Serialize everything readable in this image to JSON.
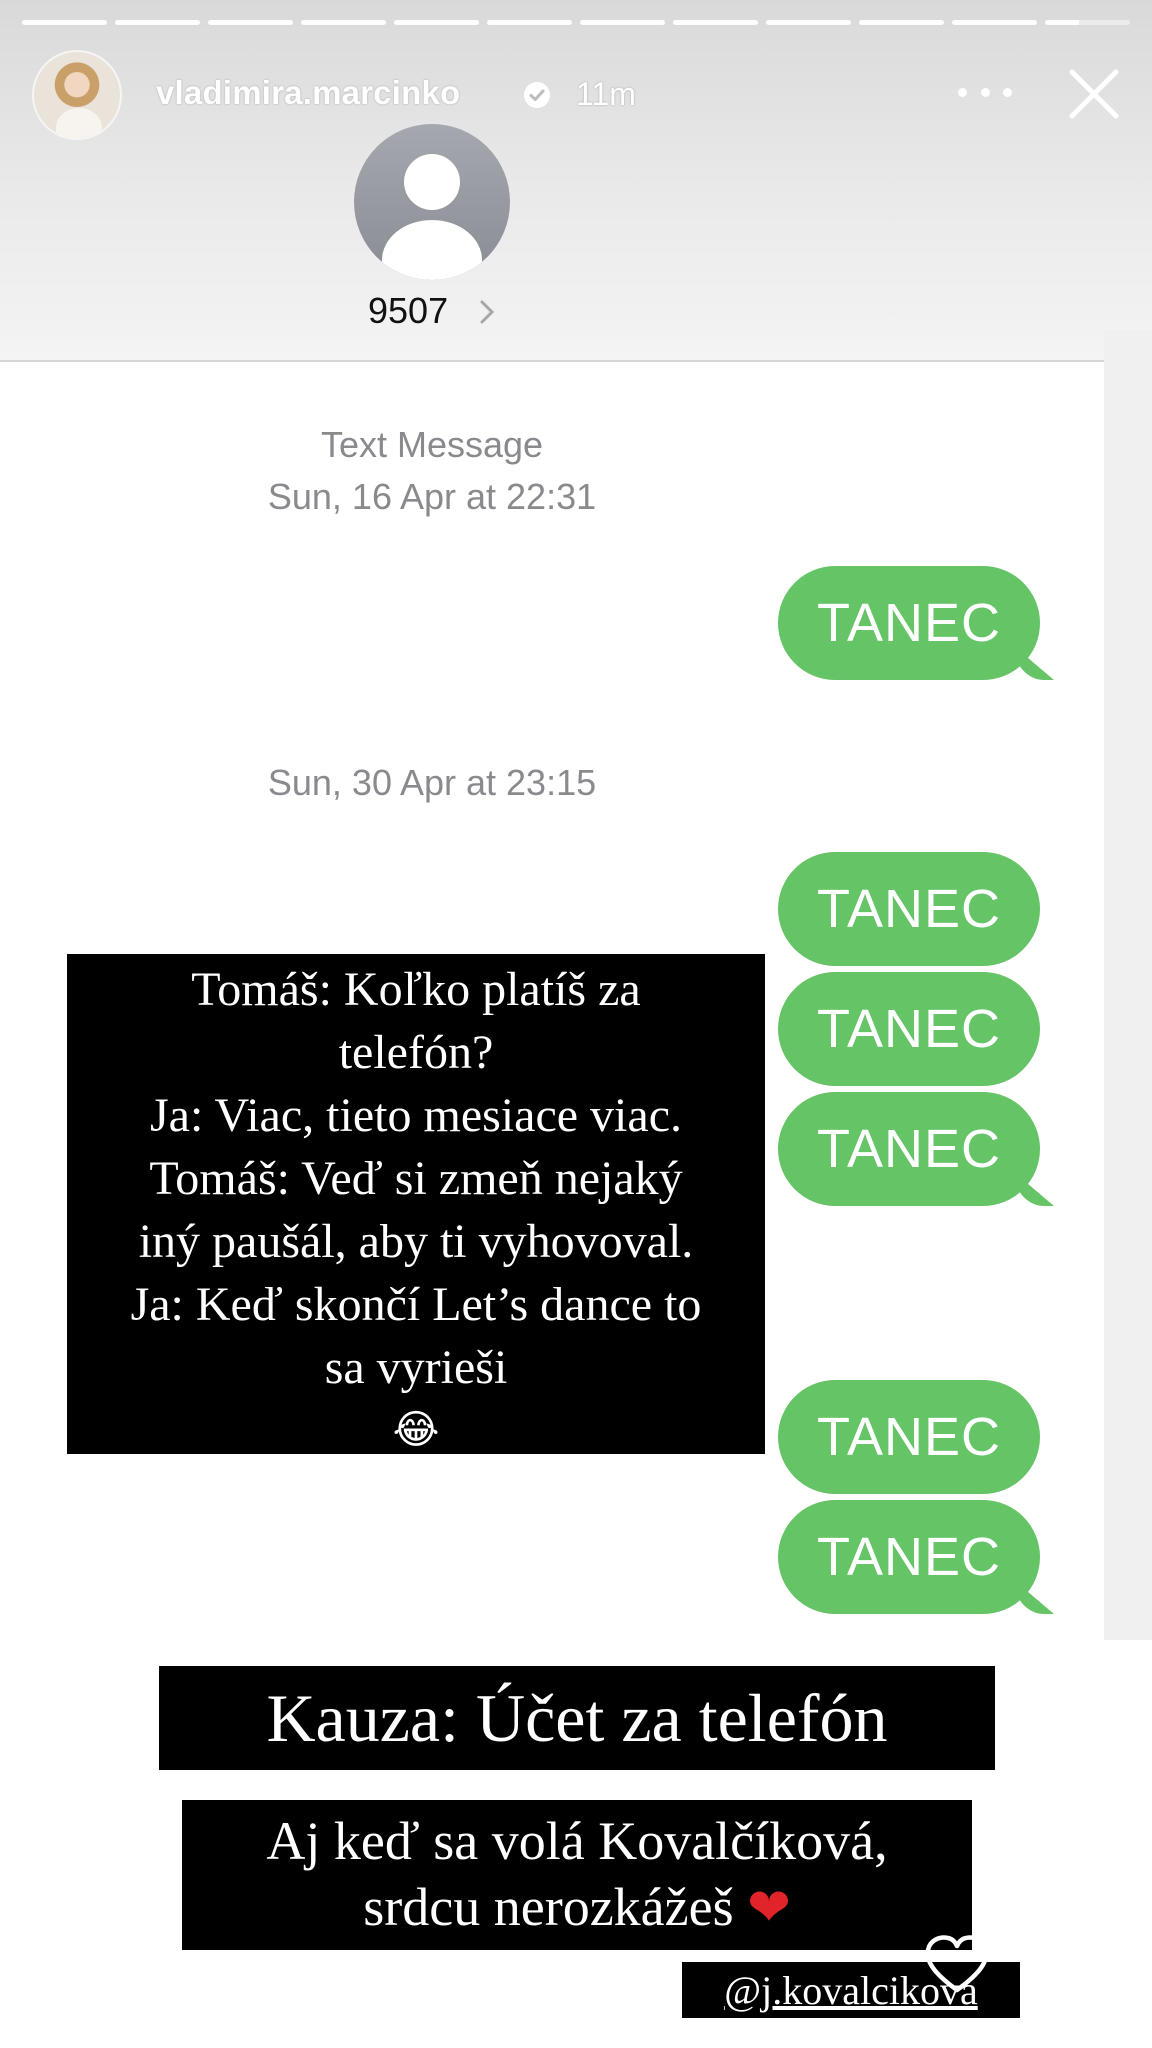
{
  "story": {
    "username": "vladimira.marcinko",
    "time_ago": "11m",
    "progress_segments": 12,
    "active_segment_progress": 0.4
  },
  "contact": {
    "name": "9507"
  },
  "thread": {
    "header_label": "Text Message",
    "date_1": "Sun, 16 Apr at 22:31",
    "date_2": "Sun, 30 Apr at 23:15",
    "messages": [
      "TANEC",
      "TANEC",
      "TANEC",
      "TANEC",
      "TANEC",
      "TANEC"
    ],
    "bubble_color": "#65c466"
  },
  "overlay": {
    "quote_lines": [
      "Tomáš: Koľko platíš za",
      "telefón?",
      "Ja: Viac, tieto mesiace viac.",
      "Tomáš: Veď si zmeň nejaký",
      "iný paušál, aby ti vyhovoval.",
      "Ja: Keď skončí Let’s dance to",
      "sa vyrieši"
    ],
    "quote_emoji": "😂",
    "title": "Kauza: Účet za telefón",
    "subtitle_line_1": "Aj keď sa volá Kovalčíková,",
    "subtitle_line_2": "srdcu nerozkážeš",
    "subtitle_emoji": "❤",
    "mention": "@j.kovalcikova"
  },
  "icons": {
    "verified": "verified-badge-icon",
    "more": "more-options-icon",
    "close": "close-icon",
    "contact": "person-placeholder-icon",
    "chevron": "chevron-right-icon",
    "like": "heart-outline-icon"
  }
}
